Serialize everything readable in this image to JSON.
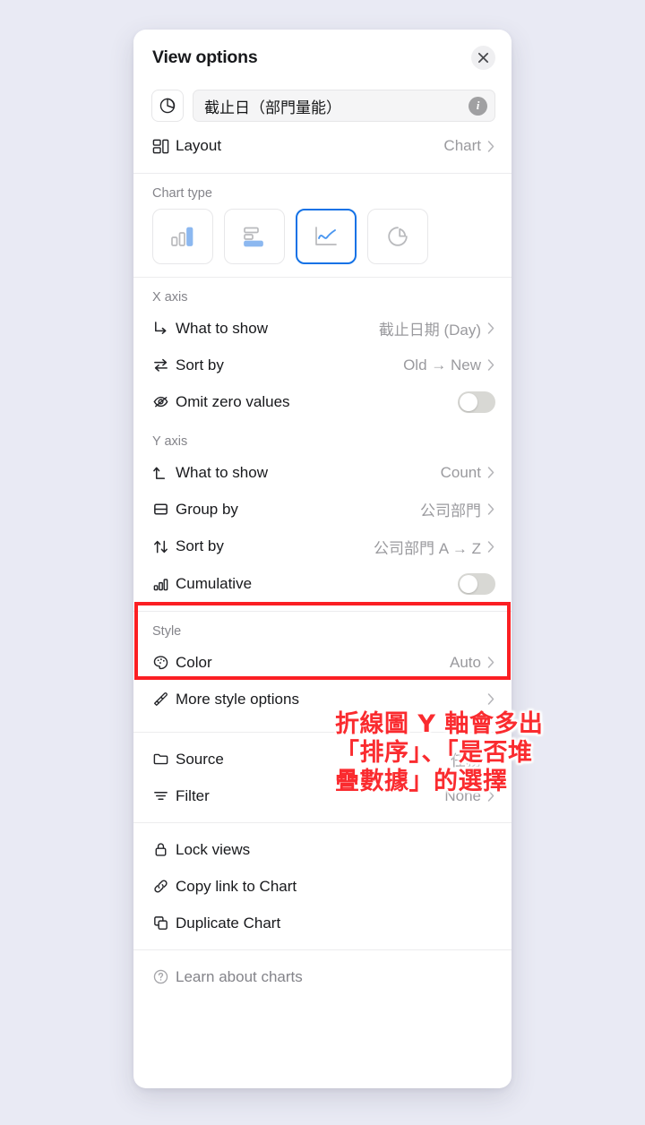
{
  "background_color": "#e9eaf4",
  "accent_color": "#1472e6",
  "annotation_color": "#fa2b2f",
  "header": {
    "title": "View options",
    "close_icon": "close-icon"
  },
  "title_field": {
    "icon": "pie-chart-icon",
    "value": "截止日（部門量能）",
    "info_icon": "info-icon"
  },
  "layout_row": {
    "icon": "layout-icon",
    "label": "Layout",
    "value": "Chart",
    "chevron": "chevron-right-icon"
  },
  "chart_type": {
    "section_label": "Chart type",
    "options": [
      {
        "name": "column-chart-icon",
        "label": "Column",
        "selected": false
      },
      {
        "name": "bar-chart-icon",
        "label": "Bar",
        "selected": false
      },
      {
        "name": "line-chart-icon",
        "label": "Line",
        "selected": true
      },
      {
        "name": "donut-chart-icon",
        "label": "Donut",
        "selected": false
      }
    ]
  },
  "x_axis": {
    "section_label": "X axis",
    "rows": [
      {
        "icon": "arrow-turn-down-right-icon",
        "label": "What to show",
        "value": "截止日期 (Day)",
        "control": "chevron"
      },
      {
        "icon": "swap-arrows-icon",
        "label": "Sort by",
        "value": "Old → New",
        "control": "chevron"
      },
      {
        "icon": "eye-off-icon",
        "label": "Omit zero values",
        "value": "",
        "control": "toggle",
        "toggle_on": false
      }
    ]
  },
  "y_axis": {
    "section_label": "Y axis",
    "rows": [
      {
        "icon": "arrow-turn-up-icon",
        "label": "What to show",
        "value": "Count",
        "control": "chevron"
      },
      {
        "icon": "split-rows-icon",
        "label": "Group by",
        "value": "公司部門",
        "control": "chevron"
      },
      {
        "icon": "sort-up-down-icon",
        "label": "Sort by",
        "value": "公司部門 A → Z",
        "control": "chevron"
      },
      {
        "icon": "bar-chart-small-icon",
        "label": "Cumulative",
        "value": "",
        "control": "toggle",
        "toggle_on": false
      }
    ]
  },
  "style": {
    "section_label": "Style",
    "rows": [
      {
        "icon": "palette-icon",
        "label": "Color",
        "value": "Auto",
        "control": "chevron"
      },
      {
        "icon": "paintbrush-icon",
        "label": "More style options",
        "value": "",
        "control": "chevron"
      }
    ]
  },
  "source_section": {
    "rows": [
      {
        "icon": "folder-icon",
        "label": "Source",
        "value": "任務",
        "control": "chevron"
      },
      {
        "icon": "filter-icon",
        "label": "Filter",
        "value": "None",
        "control": "chevron"
      }
    ]
  },
  "actions": {
    "rows": [
      {
        "icon": "lock-icon",
        "label": "Lock views"
      },
      {
        "icon": "link-icon",
        "label": "Copy link to Chart"
      },
      {
        "icon": "duplicate-icon",
        "label": "Duplicate Chart"
      }
    ]
  },
  "footer": {
    "icon": "question-circle-icon",
    "label": "Learn about charts"
  },
  "annotation": {
    "box_target": "y-axis sort-by and cumulative rows",
    "lines": [
      "折線圖 Y 軸會多出",
      "「排序」、「是否堆",
      "疊數據」的選擇"
    ]
  }
}
